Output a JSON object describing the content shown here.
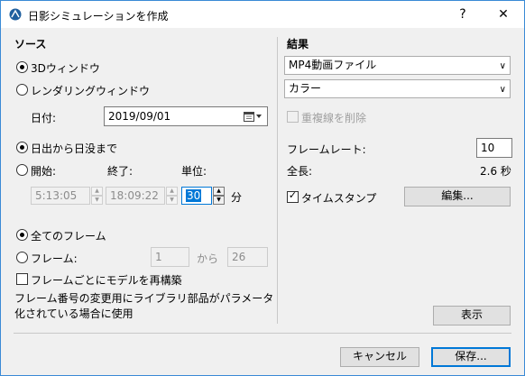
{
  "title": "日影シミュレーションを作成",
  "title_buttons": {
    "help": "?",
    "close": "✕"
  },
  "source": {
    "heading": "ソース",
    "option_3d": "3Dウィンドウ",
    "option_rendering": "レンダリングウィンドウ",
    "date_label": "日付:",
    "date_value": "2019/09/01"
  },
  "time": {
    "option_sunrise_sunset": "日出から日没まで",
    "start_label": "開始:",
    "end_label": "終了:",
    "unit_label": "単位:",
    "start_value": "5:13:05",
    "end_value": "18:09:22",
    "unit_value": "30",
    "unit_suffix": "分"
  },
  "frames": {
    "option_all": "全てのフレーム",
    "option_frames": "フレーム:",
    "from_value": "1",
    "from_word": "から",
    "to_value": "26",
    "rebuild_label": "フレームごとにモデルを再構築",
    "note": "フレーム番号の変更用にライブラリ部品がパラメータ化されている場合に使用"
  },
  "result": {
    "heading": "結果",
    "format_value": "MP4動画ファイル",
    "color_value": "カラー",
    "remove_hidden_label": "重複線を削除",
    "frame_rate_label": "フレームレート:",
    "frame_rate_value": "10",
    "length_label": "全長:",
    "length_value": "2.6 秒",
    "timestamp_label": "タイムスタンプ",
    "edit_button": "編集...",
    "show_button": "表示"
  },
  "footer": {
    "cancel": "キャンセル",
    "save": "保存..."
  },
  "icons": {
    "app": "archicad-icon",
    "calendar": "calendar-icon"
  },
  "colors": {
    "accent": "#0078d7",
    "window_border": "#3a8ad6"
  }
}
